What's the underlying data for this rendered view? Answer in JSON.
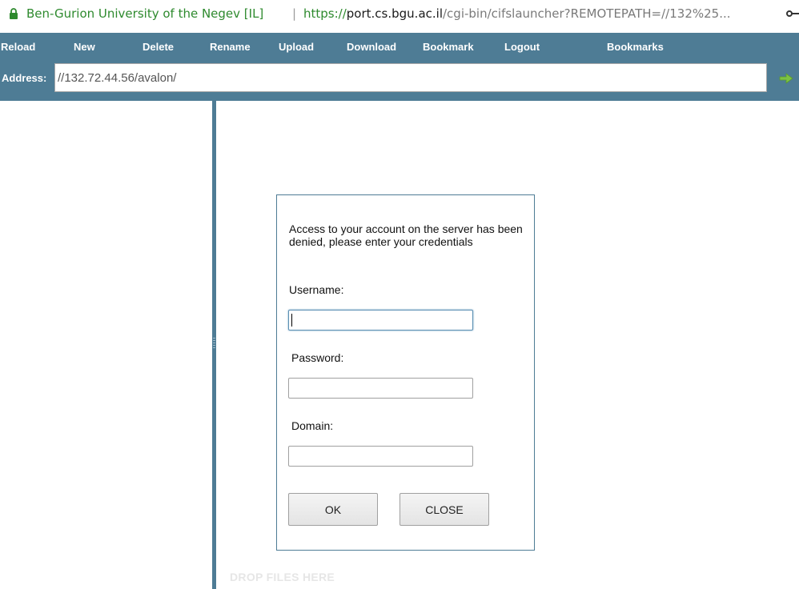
{
  "browser": {
    "org_name": "Ben-Gurion University of the Negev [IL]",
    "separator": "|",
    "url_scheme": "https://",
    "url_host": "port.cs.bgu.ac.il",
    "url_path": "/cgi-bin/cifslauncher?REMOTEPATH=//132%25..."
  },
  "toolbar": {
    "items": [
      "Reload",
      "New",
      "Delete",
      "Rename",
      "Upload",
      "Download",
      "Bookmark",
      "Logout",
      "Bookmarks"
    ],
    "address_label": "Address:",
    "address_value": "//132.72.44.56/avalon/"
  },
  "drop_zone": {
    "label": "DROP FILES HERE"
  },
  "dialog": {
    "message": "Access to your account on the server has been denied, please enter your credentials",
    "username_label": "Username:",
    "username_value": "",
    "password_label": "Password:",
    "password_value": "",
    "domain_label": "Domain:",
    "domain_value": "",
    "ok_label": "OK",
    "close_label": "CLOSE"
  },
  "colors": {
    "toolbar_blue": "#4e7c95",
    "secure_green": "#2e8a2e",
    "go_arrow": "#7cc243"
  },
  "icons": [
    "lock-icon",
    "key-icon",
    "go-arrow-icon"
  ]
}
